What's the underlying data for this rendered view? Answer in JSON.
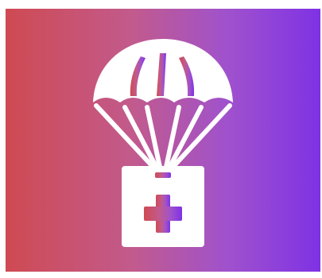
{
  "icon": {
    "name": "parachute-medical-supply-drop-icon",
    "gradient_start": "#cf4a52",
    "gradient_mid": "#c25a8c",
    "gradient_end": "#7f32e4",
    "foreground": "#ffffff"
  }
}
